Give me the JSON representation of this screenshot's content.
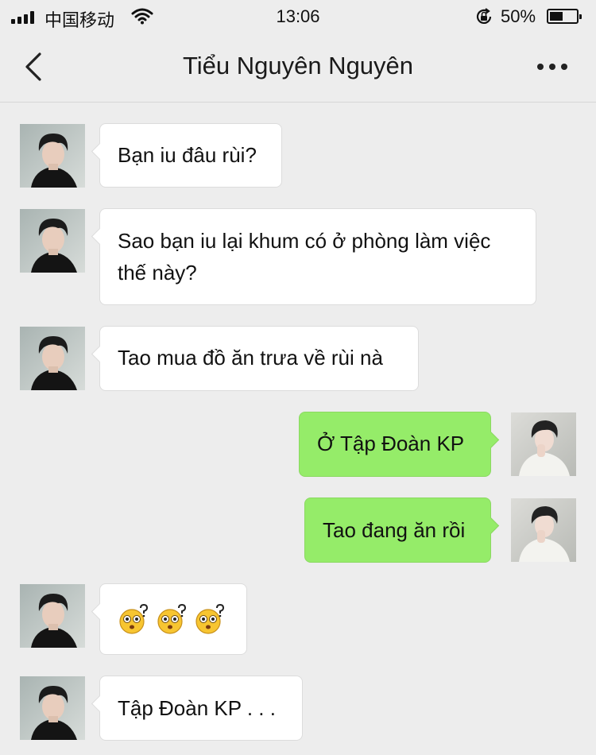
{
  "status_bar": {
    "carrier": "中国移动",
    "time": "13:06",
    "battery_percent": "50%",
    "battery_level": 0.5,
    "icons": [
      "signal-icon",
      "wifi-icon",
      "rotation-lock-icon",
      "battery-icon"
    ]
  },
  "nav": {
    "title": "Tiểu Nguyên Nguyên",
    "icons": [
      "back-chevron-icon",
      "more-dots-icon"
    ]
  },
  "colors": {
    "background": "#ededed",
    "incoming_bubble": "#ffffff",
    "outgoing_bubble": "#95ec69"
  },
  "messages": [
    {
      "side": "in",
      "text": "Bạn iu đâu rùi?"
    },
    {
      "side": "in",
      "text_line1": "Sao bạn iu lại khum có ở phòng làm việc",
      "text_line2": "thế này?"
    },
    {
      "side": "in",
      "text": "Tao mua đồ ăn trưa về rùi nà"
    },
    {
      "side": "out",
      "text": "Ở Tập Đoàn KP"
    },
    {
      "side": "out",
      "text": "Tao đang ăn rồi"
    },
    {
      "side": "in",
      "emoji": [
        "confused-face-icon",
        "confused-face-icon",
        "confused-face-icon"
      ]
    },
    {
      "side": "in",
      "text": "Tập Đoàn KP . . ."
    }
  ]
}
